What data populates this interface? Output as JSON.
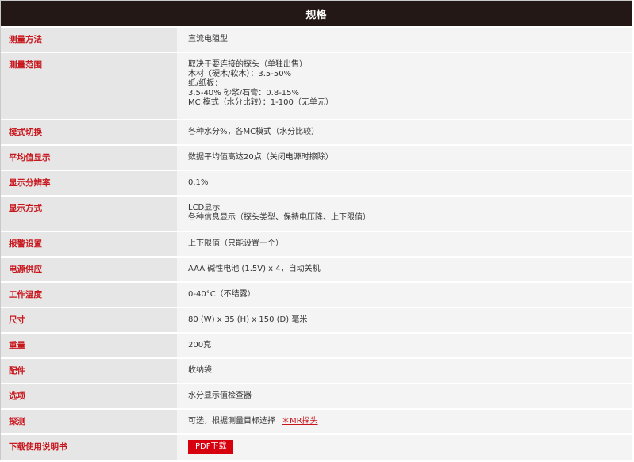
{
  "header": {
    "title": "规格"
  },
  "rows": [
    {
      "label": "测量方法",
      "lines": [
        "直流电阻型"
      ]
    },
    {
      "label": "测量范围",
      "lines": [
        "取决于要连接的探头（单独出售）",
        "木材（硬木/软木）：3.5-50%",
        "纸/纸板：",
        "3.5-40% 砂浆/石膏：0.8-15%",
        "MC 模式（水分比较）：1-100（无单元）"
      ]
    },
    {
      "label": "模式切换",
      "lines": [
        "各种水分%，各MC模式（水分比较）"
      ]
    },
    {
      "label": "平均值显示",
      "lines": [
        "数据平均值高达20点（关闭电源时擦除）"
      ]
    },
    {
      "label": "显示分辨率",
      "lines": [
        "0.1%"
      ]
    },
    {
      "label": "显示方式",
      "lines": [
        "LCD显示",
        "各种信息显示（探头类型、保持电压降、上下限值）"
      ]
    },
    {
      "label": "报警设置",
      "lines": [
        "上下限值（只能设置一个）"
      ]
    },
    {
      "label": "电源供应",
      "lines": [
        "AAA 碱性电池 (1.5V) x 4，自动关机"
      ]
    },
    {
      "label": "工作温度",
      "lines": [
        "0-40°C（不结露）"
      ]
    },
    {
      "label": "尺寸",
      "lines": [
        "80 (W) x 35 (H) x 150 (D) 毫米"
      ]
    },
    {
      "label": "重量",
      "lines": [
        "200克"
      ]
    },
    {
      "label": "配件",
      "lines": [
        "收纳袋"
      ]
    },
    {
      "label": "选项",
      "lines": [
        "水分显示值检查器"
      ]
    },
    {
      "label": "探测",
      "lines": [
        "可选，根据测量目标选择"
      ],
      "link": "＊MR探头"
    },
    {
      "label": "下载使用说明书",
      "button": "PDF下载"
    }
  ],
  "colors": {
    "header_bg": "#231815",
    "label_text": "#c8161d",
    "button_bg": "#d7000f"
  }
}
